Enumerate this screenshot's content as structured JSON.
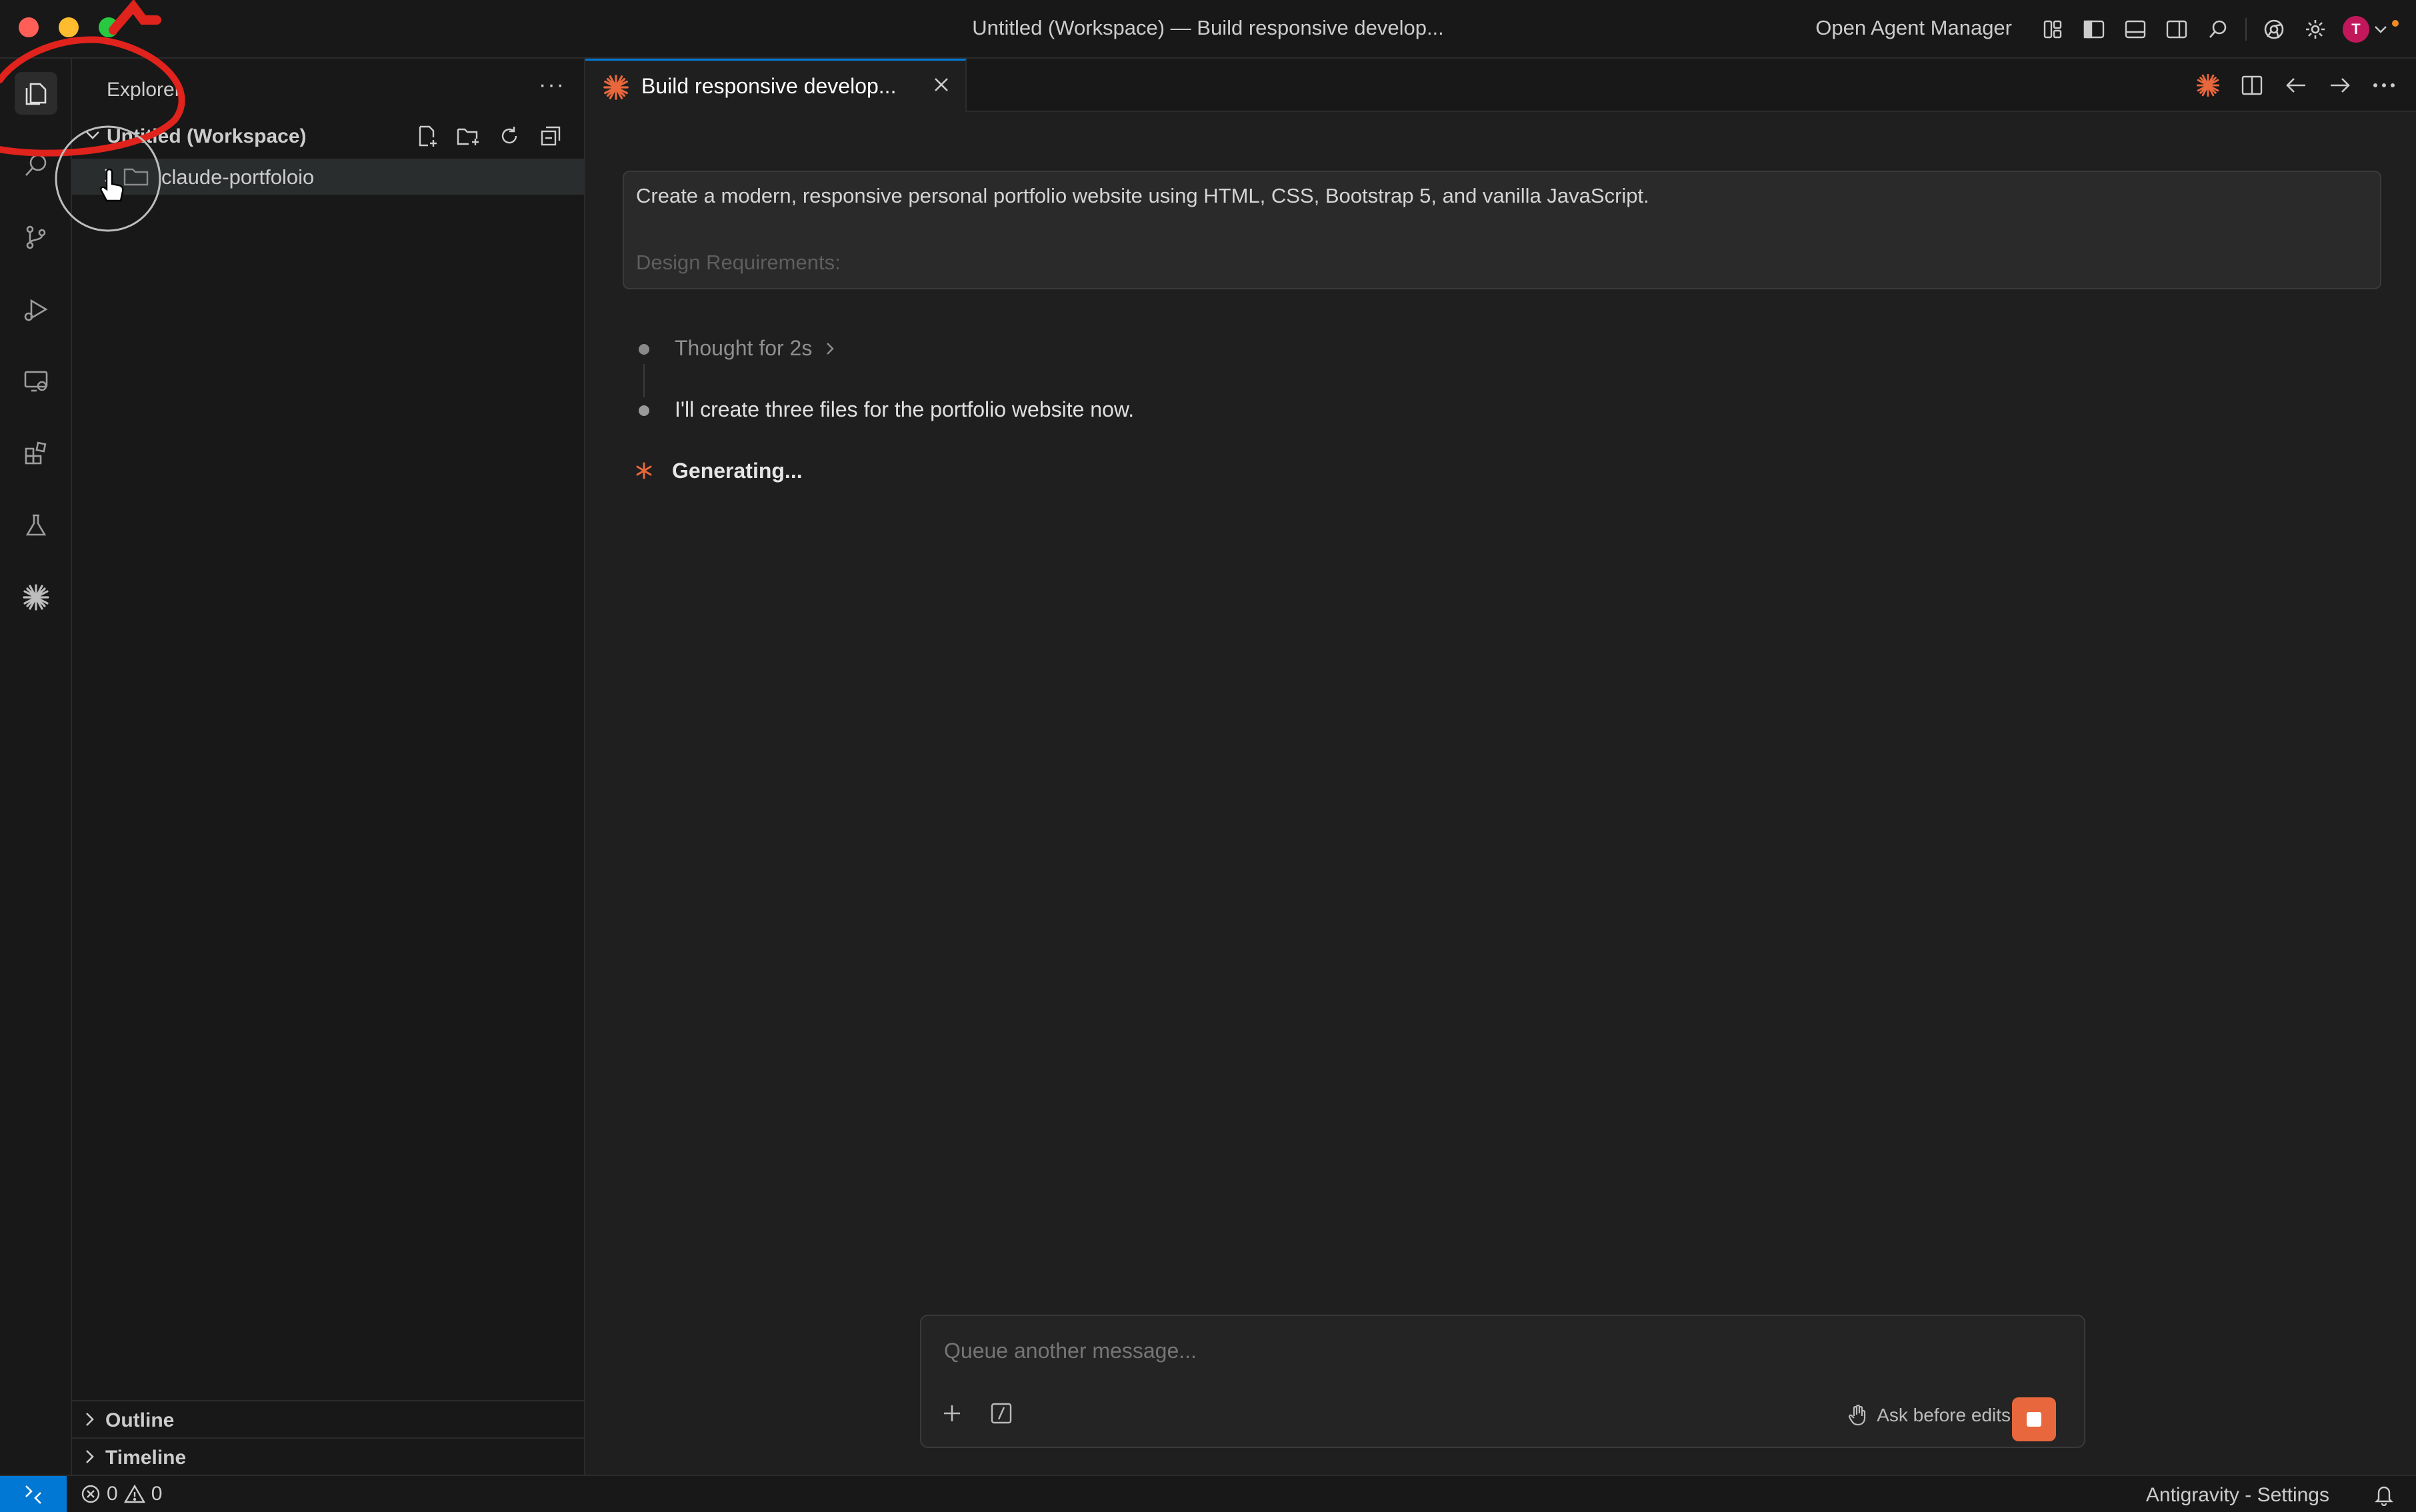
{
  "window": {
    "title": "Untitled (Workspace) — Build responsive develop...",
    "agent_manager_label": "Open Agent Manager"
  },
  "titlebar_icons": [
    "layout-icon",
    "toggle-sidebar-icon",
    "toggle-panel-icon",
    "toggle-secondary-sidebar-icon",
    "search-icon",
    "chrome-icon",
    "gear-icon",
    "account-avatar"
  ],
  "account": {
    "initial": "T"
  },
  "activity_bar": {
    "items": [
      "explorer-icon",
      "search-icon",
      "source-control-icon",
      "run-debug-icon",
      "remote-explorer-icon",
      "extensions-icon",
      "testing-icon",
      "claude-icon"
    ]
  },
  "sidebar": {
    "title": "Explorer",
    "more": "···",
    "workspace": {
      "label": "Untitled (Workspace)"
    },
    "folders": [
      {
        "label": "claude-portfoloio"
      }
    ],
    "panes": [
      {
        "label": "Outline"
      },
      {
        "label": "Timeline"
      }
    ]
  },
  "tabs": [
    {
      "label": "Build responsive develop...",
      "active": true
    }
  ],
  "editor_actions": [
    "claude-icon",
    "split-editor-icon",
    "back-arrow-icon",
    "forward-arrow-icon",
    "more-actions-icon"
  ],
  "chat": {
    "prompt": {
      "line1": "Create a modern, responsive personal portfolio website using HTML, CSS, Bootstrap 5, and vanilla JavaScript.",
      "line2": "Design Requirements:"
    },
    "thought": "Thought for 2s",
    "message": "I'll create three files for the portfolio website now.",
    "status": "Generating..."
  },
  "composer": {
    "placeholder": "Queue another message...",
    "ask_before_edits": "Ask before edits"
  },
  "statusbar": {
    "errors": "0",
    "warnings": "0",
    "right_label": "Antigravity - Settings"
  },
  "colors": {
    "accent": "#0078d4",
    "claude_orange": "#e8673c",
    "annotation_red": "#e0231c"
  }
}
